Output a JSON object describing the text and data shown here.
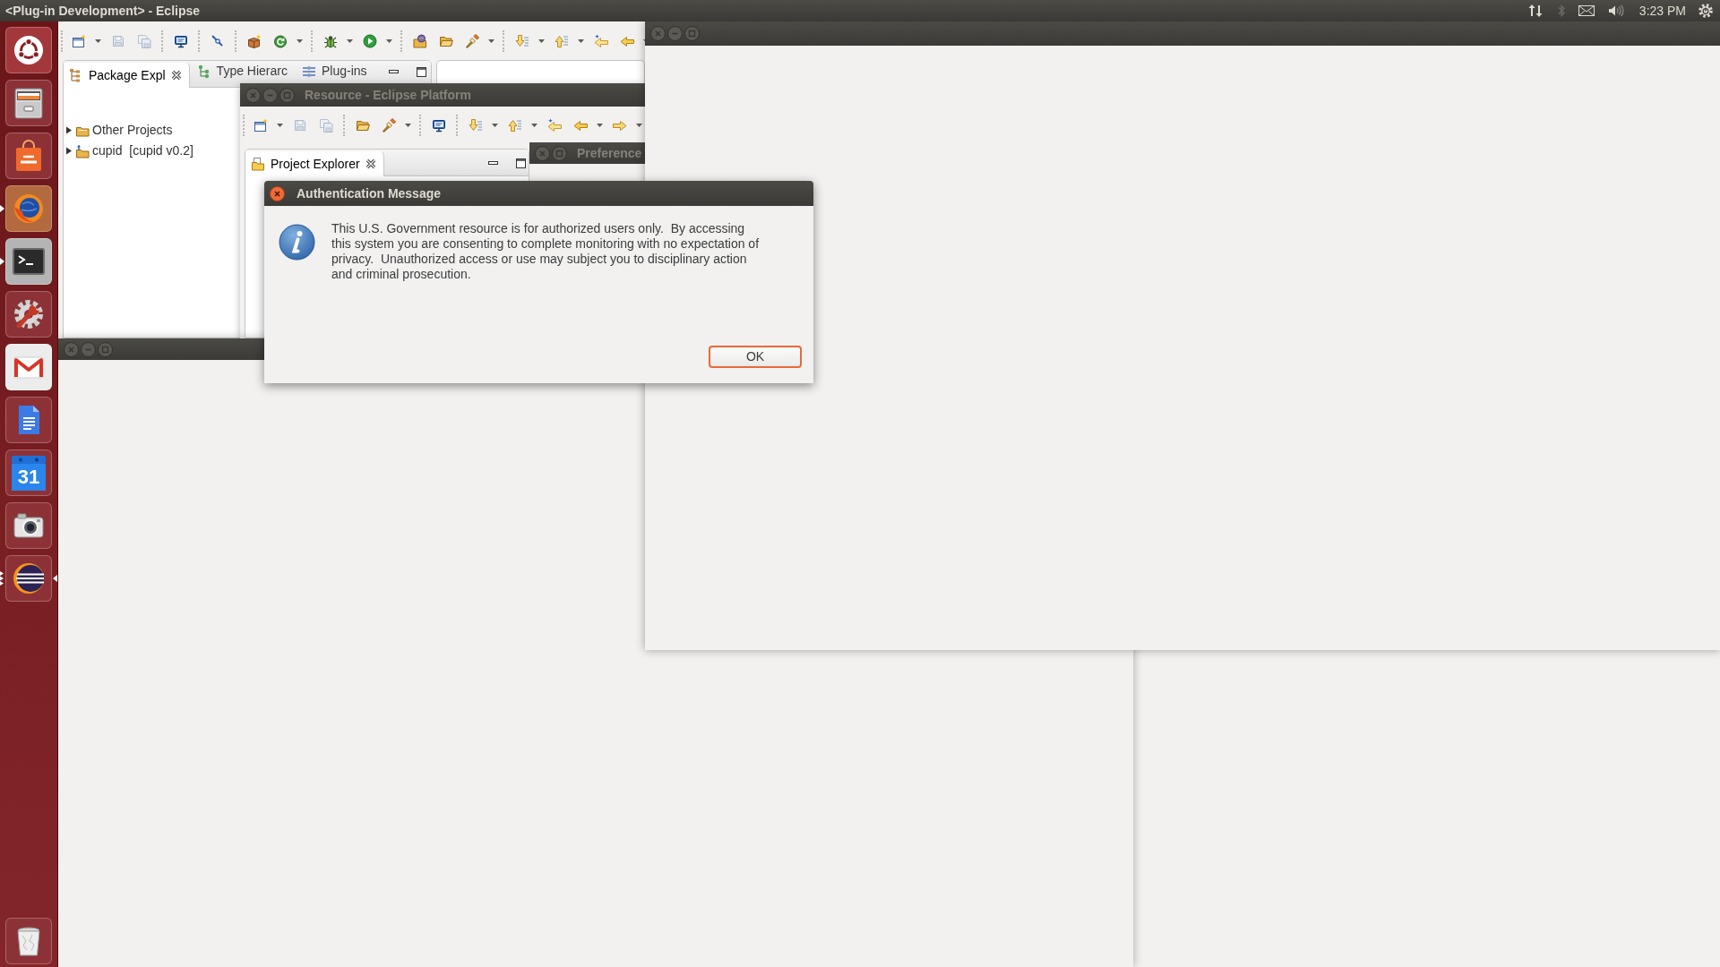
{
  "top_panel": {
    "window_title": "<Plug-in Development> - Eclipse",
    "clock": "3:23 PM"
  },
  "launcher": [
    {
      "running": false,
      "multiple_windows": false,
      "focused": false
    },
    {
      "running": false,
      "multiple_windows": false,
      "focused": false
    },
    {
      "running": false,
      "multiple_windows": false,
      "focused": false
    },
    {
      "running": true,
      "multiple_windows": false,
      "focused": false
    },
    {
      "running": true,
      "multiple_windows": false,
      "focused": false
    },
    {
      "running": false,
      "multiple_windows": false,
      "focused": false
    },
    {
      "running": false,
      "multiple_windows": false,
      "focused": false
    },
    {
      "running": false,
      "multiple_windows": false,
      "focused": false
    },
    {
      "running": false,
      "multiple_windows": false,
      "focused": false,
      "date": "31"
    },
    {
      "running": false,
      "multiple_windows": false,
      "focused": false
    },
    {
      "running": true,
      "multiple_windows": true,
      "focused": true
    },
    {
      "running": false,
      "multiple_windows": false,
      "focused": false
    }
  ],
  "main_window": {
    "tabs": [
      {
        "label": "Package Expl",
        "selected": true
      },
      {
        "label": "Type Hierarc",
        "selected": false
      },
      {
        "label": "Plug-ins",
        "selected": false
      }
    ],
    "tree": [
      {
        "label": "Other Projects",
        "expanded": false
      },
      {
        "label": "cupid  [cupid v0.2]",
        "expanded": false
      }
    ]
  },
  "resource_window": {
    "title": "Resource - Eclipse Platform",
    "active": false,
    "tabs": [
      {
        "label": "Project Explorer",
        "selected": true
      }
    ]
  },
  "preferences_window": {
    "title": "Preference",
    "active": false
  },
  "dialog": {
    "title": "Authentication Message",
    "active": true,
    "message": "This U.S. Government resource is for authorized users only.  By accessing this system you are consenting to complete monitoring with no expectation of privacy.  Unauthorized access or use may subject you to disciplinary action and criminal prosecution.",
    "buttons": [
      {
        "label": "OK",
        "default": true
      }
    ]
  }
}
